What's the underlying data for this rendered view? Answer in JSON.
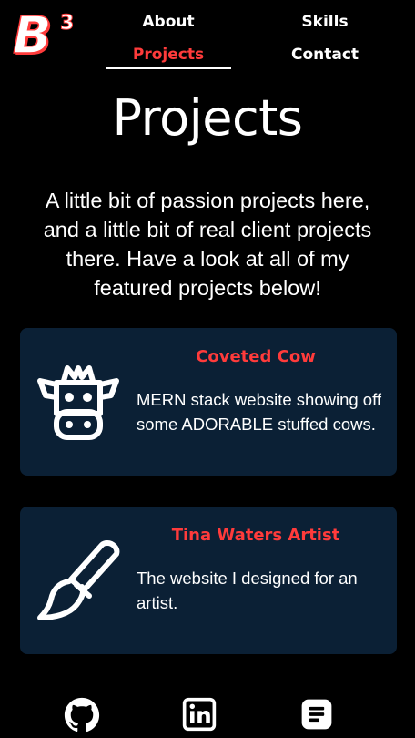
{
  "brand": {
    "logo_letter": "B",
    "logo_sup": "3"
  },
  "nav": {
    "about": "About",
    "skills": "Skills",
    "projects": "Projects",
    "contact": "Contact",
    "active": "Projects"
  },
  "page": {
    "title": "Projects",
    "intro": "A little bit of passion projects here, and a little bit of real client projects there. Have a look at all of my featured projects below!"
  },
  "projects": [
    {
      "title": "Coveted Cow",
      "description": "MERN stack website showing off some ADORABLE stuffed cows.",
      "icon": "cow-icon"
    },
    {
      "title": "Tina Waters Artist",
      "description": "The website I designed for an artist.",
      "icon": "paintbrush-icon"
    }
  ],
  "footer": {
    "icons": [
      "github-icon",
      "linkedin-icon",
      "resume-icon"
    ]
  },
  "colors": {
    "background": "#000000",
    "accent": "#ff3b3b",
    "card": "#0b2035",
    "text": "#ffffff"
  }
}
